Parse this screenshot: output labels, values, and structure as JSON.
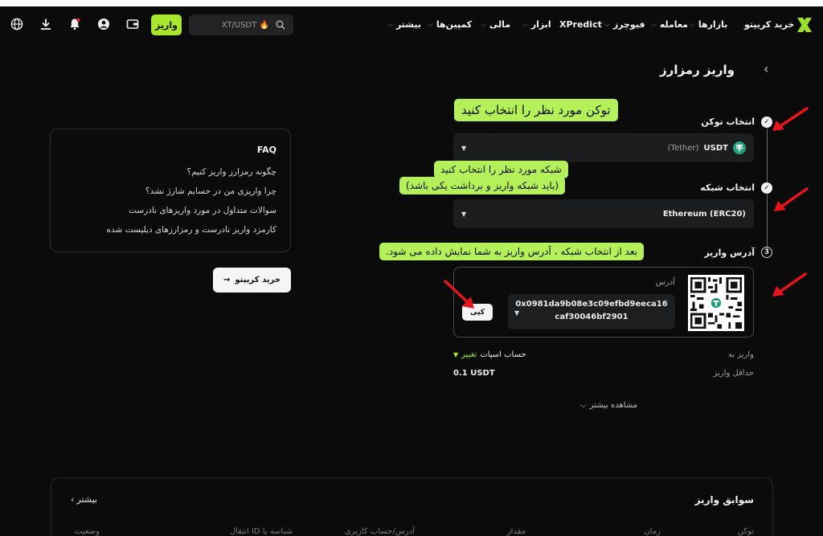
{
  "nav": {
    "items": [
      "خرید کریپتو",
      "بازارها",
      "معامله",
      "فیوچرز",
      "XPredict",
      "ابزار",
      "مالی",
      "کمپین‌ها",
      "بیشتر"
    ],
    "search_placeholder": "XT/USDT 🔥",
    "deposit_label": "واریز"
  },
  "page": {
    "title": "واریز رمزارز"
  },
  "steps": {
    "token_label": "انتخاب توکن",
    "token_value": "USDT",
    "token_sub": "(Tether)",
    "network_label": "انتخاب شبکه",
    "network_value": "Ethereum (ERC20)",
    "address_step_num": "3",
    "address_label": "آدرس واریز"
  },
  "tooltips": {
    "token": "توکن مورد نظر را انتخاب کنید",
    "network_line1": "شبکه مورد نظر را انتخاب کنید",
    "network_line2": "(باید شبکه واریز و برداشت یکی باشد)",
    "address": "بعد از انتخاب شبکه ، آدرس واریز به شما نمایش داده می شود."
  },
  "address": {
    "label": "آدرس",
    "value": "0x0981da9b08e3c09efbd9eeca16caf30046bf2901",
    "copy_label": "کپی"
  },
  "details": {
    "deposit_to_label": "واریز به",
    "deposit_to_value": "حساب اسپات",
    "change_label": "تغییر",
    "min_label": "حداقل واریز",
    "min_value": "0.1 USDT",
    "show_more": "مشاهده بیشتر"
  },
  "faq": {
    "title": "FAQ",
    "questions": [
      "چگونه رمزارز واریز کنیم؟",
      "چرا واریزی من در حسابم شارژ نشد؟",
      "سوالات متداول در مورد واریزهای نادرست",
      "کارمزد واریز نادرست و رمزارزهای دیلیست شده"
    ],
    "buy_button": "خرید کریپتو"
  },
  "history": {
    "title": "سوابق واریز",
    "more": "بیشتر",
    "columns": [
      "توکن",
      "زمان",
      "مقدار",
      "آدرس/حساب کاربری",
      "شناسه یا ID انتقال",
      "وضعیت"
    ]
  },
  "colors": {
    "accent": "#a8e62c",
    "tooltip": "#b4f05a",
    "arrow": "#e8141b",
    "background": "#0b0b0c"
  }
}
